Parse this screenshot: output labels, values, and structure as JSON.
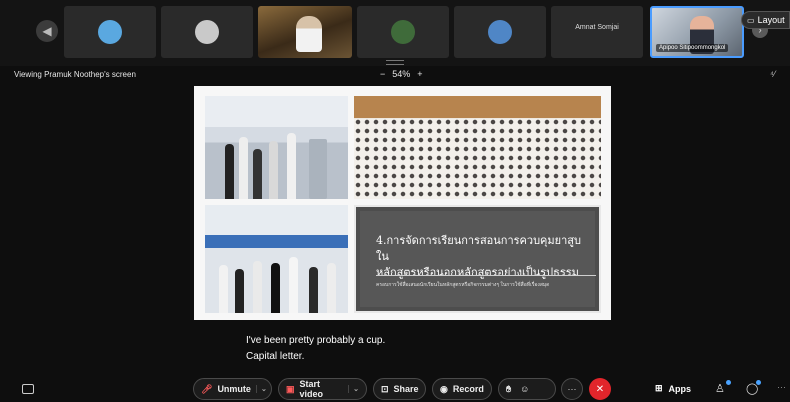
{
  "participants": {
    "tiles": [
      {
        "kind": "avatar",
        "color": "#5aa8e0"
      },
      {
        "kind": "avatar",
        "color": "#c9c9c9"
      },
      {
        "kind": "video"
      },
      {
        "kind": "avatar",
        "color": "#3f6b3a"
      },
      {
        "kind": "avatar",
        "color": "#4f86c6"
      },
      {
        "kind": "name",
        "name": "Amnat Somjai"
      },
      {
        "kind": "active",
        "name": "Apipoo Sitipoommongkol"
      }
    ]
  },
  "layout_button": {
    "label": "Layout",
    "icon": "layout-icon"
  },
  "share_bar": {
    "viewing": "Viewing Pramuk Noothep's screen",
    "zoom_minus": "−",
    "zoom_level": "54%",
    "zoom_plus": "+"
  },
  "slide": {
    "title_line1": "4.การจัดการเรียนการสอนการควบคุมยาสูบใน",
    "title_line2": "หลักสูตรหรือนอกหลักสูตรอย่างเป็นรูปธรรม",
    "subtitle": "ครอบการใช้สื่อเสนอนักเรียนในหลักสูตรหรือกิจกรรมต่างๆ ในการใช้สื่อที่เรื่องสมุด"
  },
  "captions": {
    "line1": "I've been pretty probably a cup.",
    "line2": "Capital letter."
  },
  "toolbar": {
    "unmute": "Unmute",
    "start_video": "Start video",
    "share": "Share",
    "record": "Record",
    "apps": "Apps"
  },
  "colors": {
    "background": "#0e0e0e",
    "accent": "#4a9cff",
    "leave": "#e2252b",
    "muted_red": "#ff5a5a"
  }
}
